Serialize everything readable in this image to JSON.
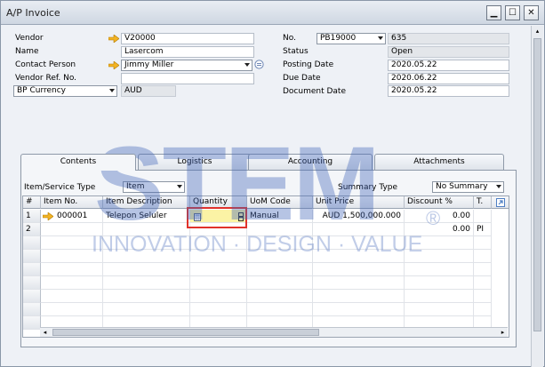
{
  "window": {
    "title": "A/P Invoice"
  },
  "header": {
    "vendor": {
      "label": "Vendor",
      "value": "V20000"
    },
    "name": {
      "label": "Name",
      "value": "Lasercom"
    },
    "contact": {
      "label": "Contact Person",
      "value": "Jimmy Miller"
    },
    "vendor_ref": {
      "label": "Vendor Ref. No.",
      "value": ""
    },
    "currency": {
      "label": "BP Currency",
      "value": "AUD"
    },
    "no": {
      "label": "No.",
      "series": "PB19000",
      "value": "635"
    },
    "status": {
      "label": "Status",
      "value": "Open"
    },
    "posting_date": {
      "label": "Posting Date",
      "value": "2020.05.22"
    },
    "due_date": {
      "label": "Due Date",
      "value": "2020.06.22"
    },
    "document_date": {
      "label": "Document Date",
      "value": "2020.05.22"
    }
  },
  "tabs": [
    "Contents",
    "Logistics",
    "Accounting",
    "Attachments"
  ],
  "contents": {
    "item_service_type_label": "Item/Service Type",
    "item_service_type_value": "Item",
    "summary_type_label": "Summary Type",
    "summary_type_value": "No Summary",
    "columns": [
      "#",
      "Item No.",
      "Item Description",
      "Quantity",
      "UoM Code",
      "Unit Price",
      "Discount %",
      "T."
    ],
    "rows": [
      {
        "num": "1",
        "item_no": "000001",
        "desc": "Telepon Seluler",
        "qty": "",
        "uom": "Manual",
        "price": "AUD 1,500,000.000",
        "disc": "0.00",
        "tax": ""
      },
      {
        "num": "2",
        "item_no": "",
        "desc": "",
        "qty": "",
        "uom": "",
        "price": "",
        "disc": "0.00",
        "tax": "PI"
      }
    ]
  },
  "watermark": {
    "main": "STEM",
    "tagline": "INNOVATION · DESIGN · VALUE",
    "reg": "®"
  },
  "colors": {
    "highlight": "#e0322b",
    "qty_cell": "#fbf3a5",
    "accent": "#4f7fc4"
  }
}
